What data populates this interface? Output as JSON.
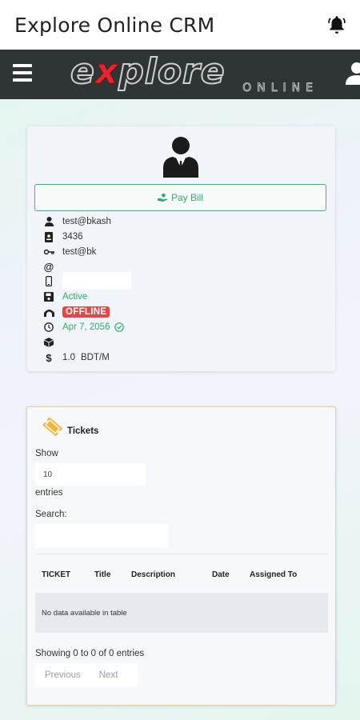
{
  "app": {
    "title": "Explore Online CRM"
  },
  "brand": {
    "logo_main_pre": "e",
    "logo_x": "x",
    "logo_main_post": "plore",
    "logo_sub": "ONLINE",
    "accent": "#e3262f",
    "navbar_color": "#2f3534"
  },
  "profile": {
    "pay_bill_label": "Pay Bill",
    "username": "test@bkash",
    "customer_id": "3436",
    "password": "test@bk",
    "email": "",
    "phone": "",
    "account_status": "Active",
    "connection_status": "OFFLINE",
    "expiry_date": "Apr 7, 2056",
    "package": "",
    "rate": "1.0",
    "rate_unit": "BDT/M",
    "icons": [
      "user-icon",
      "id-card-icon",
      "key-icon",
      "at-icon",
      "mobile-icon",
      "save-icon",
      "connection-icon",
      "clock-icon",
      "box-icon",
      "dollar-icon"
    ]
  },
  "tickets": {
    "title": "Tickets",
    "show_label": "Show",
    "entries_value": "10",
    "entries_label": "entries",
    "search_label": "Search:",
    "columns": [
      "TICKET",
      "Title",
      "Description",
      "Date",
      "Assigned To"
    ],
    "empty_message": "No data available in table",
    "info": "Showing 0 to 0 of 0 entries",
    "prev_label": "Previous",
    "next_label": "Next"
  },
  "colors": {
    "success": "#2fae6b",
    "danger": "#e04848",
    "ticket_border": "#f2cf8a"
  }
}
